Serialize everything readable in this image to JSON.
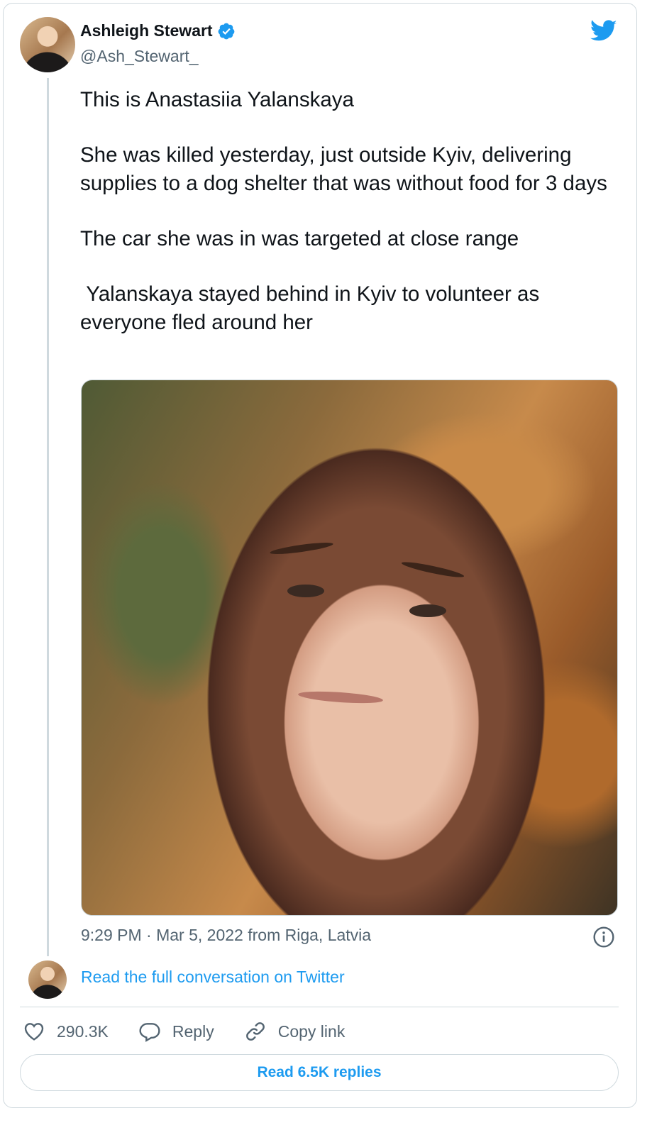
{
  "author": {
    "name": "Ashleigh Stewart",
    "handle": "@Ash_Stewart_",
    "verified": true
  },
  "tweet": {
    "line1": "This is Anastasiia Yalanskaya",
    "flag": "ukraine-flag",
    "paragraph2": "She was killed yesterday, just outside Kyiv, delivering supplies to a dog shelter that was without food for 3 days",
    "paragraph3": "The car she was in was targeted at close range",
    "paragraph4": " Yalanskaya stayed behind in Kyiv to volunteer as everyone fled around her"
  },
  "meta": {
    "time": "9:29 PM",
    "separator": "·",
    "date_location": "Mar 5, 2022 from Riga, Latvia"
  },
  "links": {
    "read_full": "Read the full conversation on Twitter"
  },
  "actions": {
    "likes": "290.3K",
    "reply": "Reply",
    "copy_link": "Copy link"
  },
  "read_replies": "Read 6.5K replies",
  "colors": {
    "accent": "#1d9bf0",
    "muted": "#536471",
    "border": "#cfd9de"
  }
}
